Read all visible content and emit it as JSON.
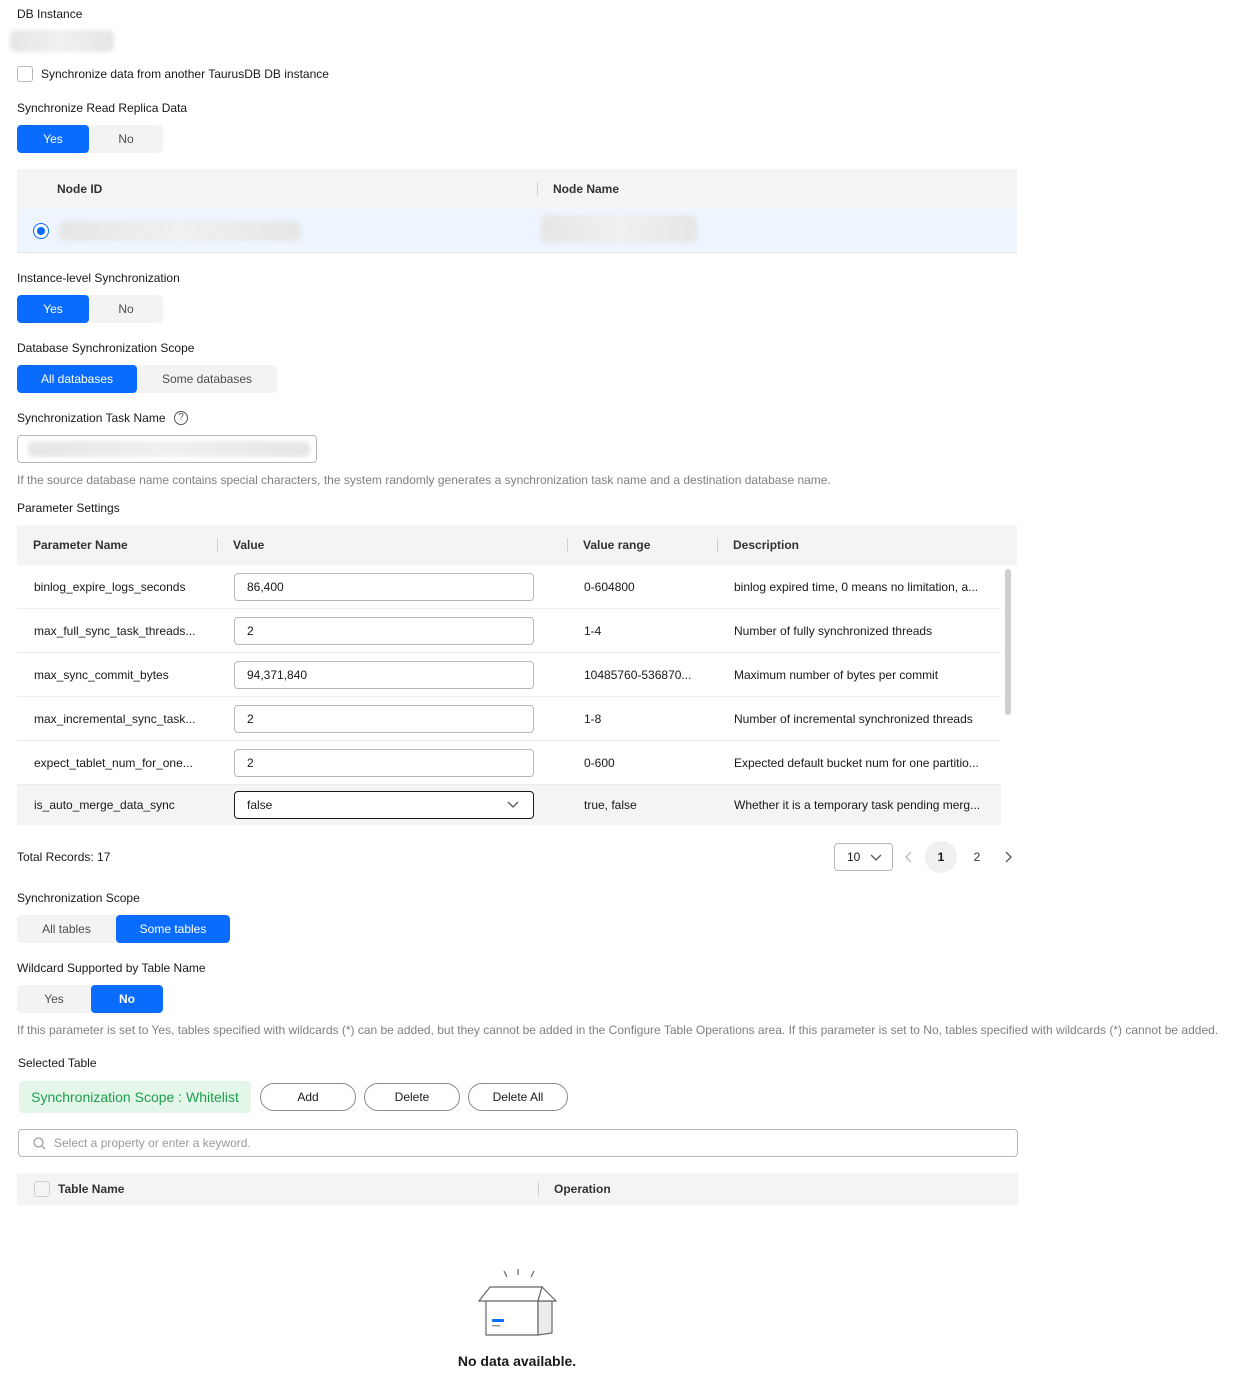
{
  "db_instance": {
    "label": "DB Instance"
  },
  "sync_other": {
    "label": "Synchronize data from another TaurusDB DB instance"
  },
  "read_replica": {
    "label": "Synchronize Read Replica Data",
    "options": [
      "Yes",
      "No"
    ],
    "selected": "Yes"
  },
  "node_table": {
    "columns": [
      "Node ID",
      "Node Name"
    ]
  },
  "instance_sync": {
    "label": "Instance-level Synchronization",
    "options": [
      "Yes",
      "No"
    ],
    "selected": "Yes"
  },
  "db_scope": {
    "label": "Database Synchronization Scope",
    "options": [
      "All databases",
      "Some databases"
    ],
    "selected": "All databases"
  },
  "task_name": {
    "label": "Synchronization Task Name",
    "hint": "If the source database name contains special characters, the system randomly generates a synchronization task name and a destination database name."
  },
  "params": {
    "label": "Parameter Settings",
    "columns": [
      "Parameter Name",
      "Value",
      "Value range",
      "Description"
    ],
    "rows": [
      {
        "name": "binlog_expire_logs_seconds",
        "value": "86,400",
        "range": "0-604800",
        "desc": "binlog expired time, 0 means no limitation, a..."
      },
      {
        "name": "max_full_sync_task_threads...",
        "value": "2",
        "range": "1-4",
        "desc": "Number of fully synchronized threads"
      },
      {
        "name": "max_sync_commit_bytes",
        "value": "94,371,840",
        "range": "10485760-536870...",
        "desc": "Maximum number of bytes per commit"
      },
      {
        "name": "max_incremental_sync_task...",
        "value": "2",
        "range": "1-8",
        "desc": "Number of incremental synchronized threads"
      },
      {
        "name": "expect_tablet_num_for_one...",
        "value": "2",
        "range": "0-600",
        "desc": "Expected default bucket num for one partitio..."
      },
      {
        "name": "is_auto_merge_data_sync",
        "value": "false",
        "range": "true, false",
        "desc": "Whether it is a temporary task pending merg..."
      }
    ],
    "total": "Total Records: 17",
    "page_size": "10",
    "pages": [
      "1",
      "2"
    ],
    "current_page": "1"
  },
  "sync_scope": {
    "label": "Synchronization Scope",
    "options": [
      "All tables",
      "Some tables"
    ],
    "selected": "Some tables"
  },
  "wildcard": {
    "label": "Wildcard Supported by Table Name",
    "options": [
      "Yes",
      "No"
    ],
    "selected": "No",
    "hint": "If this parameter is set to Yes, tables specified with wildcards (*) can be added, but they cannot be added in the Configure Table Operations area. If this parameter is set to No, tables specified with wildcards (*) cannot be added."
  },
  "selected_table": {
    "label": "Selected Table",
    "scope_tag": "Synchronization Scope : Whitelist",
    "add": "Add",
    "delete": "Delete",
    "delete_all": "Delete All",
    "search_placeholder": "Select a property or enter a keyword.",
    "columns": [
      "Table Name",
      "Operation"
    ],
    "empty": "No data available."
  },
  "colors": {
    "primary": "#0a6cff",
    "success_bg": "#e4f5e9",
    "success_text": "#1c9f4b"
  }
}
